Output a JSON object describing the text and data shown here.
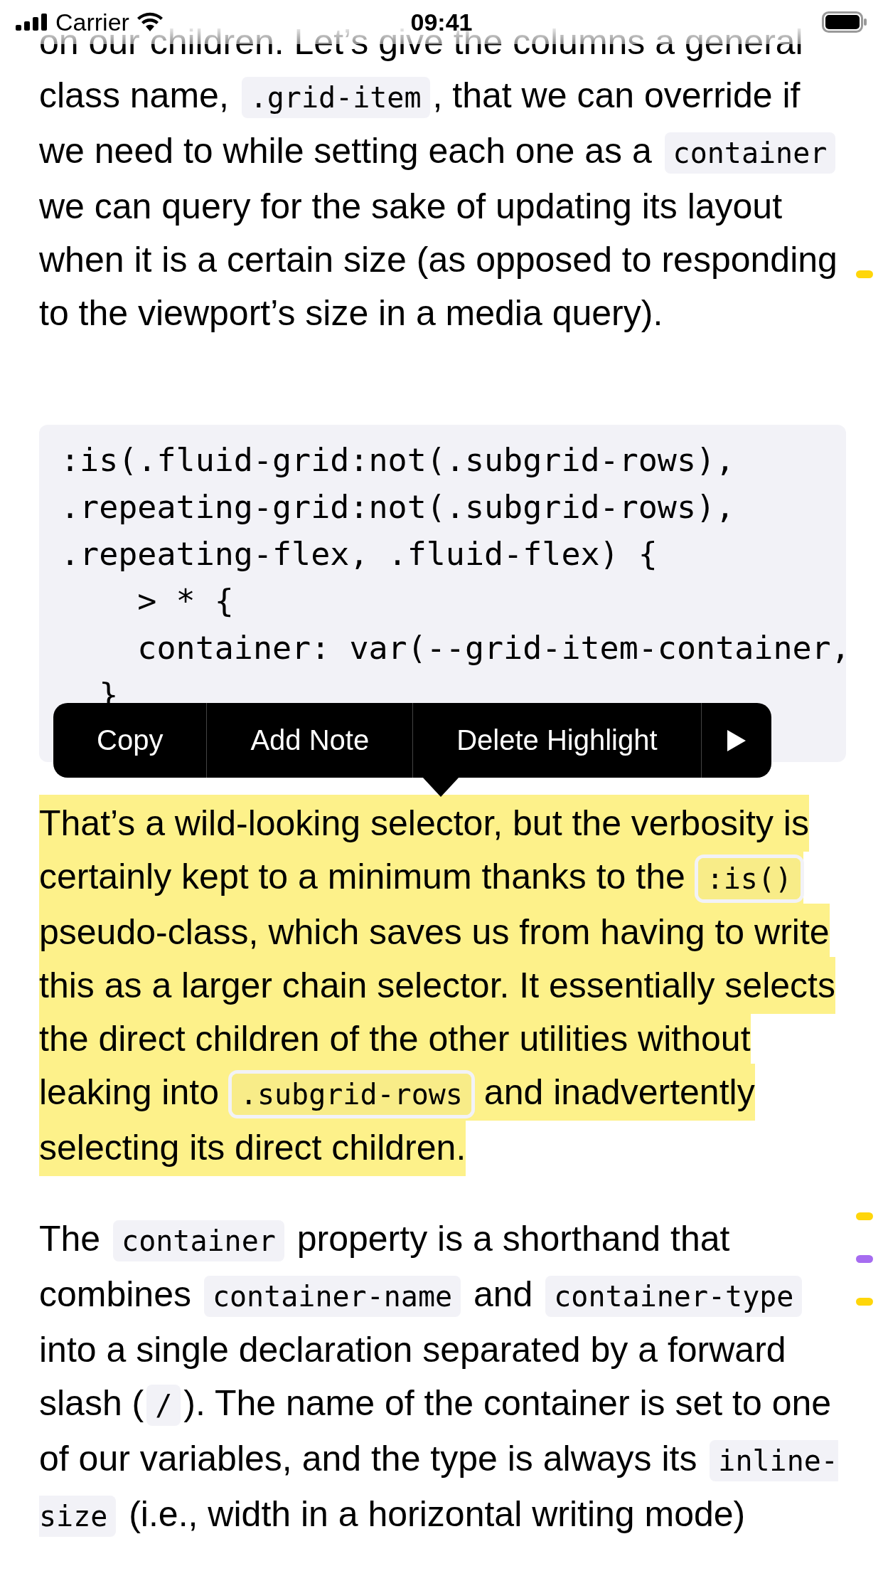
{
  "status_bar": {
    "carrier": "Carrier",
    "time": "09:41"
  },
  "content": [
    {
      "kind": "paragraph",
      "highlighted": false,
      "marks": [
        {
          "color": "#ffd60a"
        }
      ],
      "segments": [
        {
          "kind": "text",
          "text": "on our children. Let’s give the columns a general class name, "
        },
        {
          "kind": "code",
          "text": ".grid-item"
        },
        {
          "kind": "text",
          "text": ", that we can override if we need to while setting each one as a "
        },
        {
          "kind": "code",
          "text": "container"
        },
        {
          "kind": "text",
          "text": " we can query for the sake of updating its layout when it is a certain size (as opposed to responding to the viewport’s size in a media query)."
        }
      ]
    },
    {
      "kind": "code",
      "lines": [
        ":is(.fluid-grid:not(.subgrid-rows),",
        ".repeating-grid:not(.subgrid-rows),",
        ".repeating-flex, .fluid-flex) {",
        "    > * {",
        "    container: var(--grid-item-container,",
        "  }"
      ]
    },
    {
      "kind": "paragraph",
      "highlighted": true,
      "segments": [
        {
          "kind": "text",
          "text": "That’s a wild-looking selector, but the verbosity is certainly kept to a minimum thanks to the "
        },
        {
          "kind": "code",
          "text": ":is()"
        },
        {
          "kind": "text",
          "text": " pseudo-class, which saves us from having to write this as a larger chain selector. It essentially selects the direct children of the other utilities without leaking into "
        },
        {
          "kind": "code",
          "text": ".subgrid-rows"
        },
        {
          "kind": "text",
          "text": " and inadvertently selecting its direct children."
        }
      ]
    },
    {
      "kind": "paragraph",
      "highlighted": false,
      "marks": [
        {
          "color": "#ffd60a"
        },
        {
          "color": "#a66cf0"
        },
        {
          "color": "#ffd60a"
        }
      ],
      "segments": [
        {
          "kind": "text",
          "text": "The "
        },
        {
          "kind": "code",
          "text": "container"
        },
        {
          "kind": "text",
          "text": " property is a shorthand that combines "
        },
        {
          "kind": "code",
          "text": "container-name"
        },
        {
          "kind": "text",
          "text": " and "
        },
        {
          "kind": "code",
          "text": "container-type"
        },
        {
          "kind": "text",
          "text": " into a single declaration separated by a forward slash ("
        },
        {
          "kind": "code",
          "text": "/"
        },
        {
          "kind": "text",
          "text": "). The name of the container is set to one of our variables, and the type is always its "
        },
        {
          "kind": "code",
          "text": "inline-size"
        },
        {
          "kind": "text",
          "text": " (i.e., width in a horizontal writing mode)"
        }
      ]
    }
  ],
  "context_menu": {
    "items": [
      {
        "label": "Copy"
      },
      {
        "label": "Add Note"
      },
      {
        "label": "Delete Highlight"
      }
    ]
  }
}
